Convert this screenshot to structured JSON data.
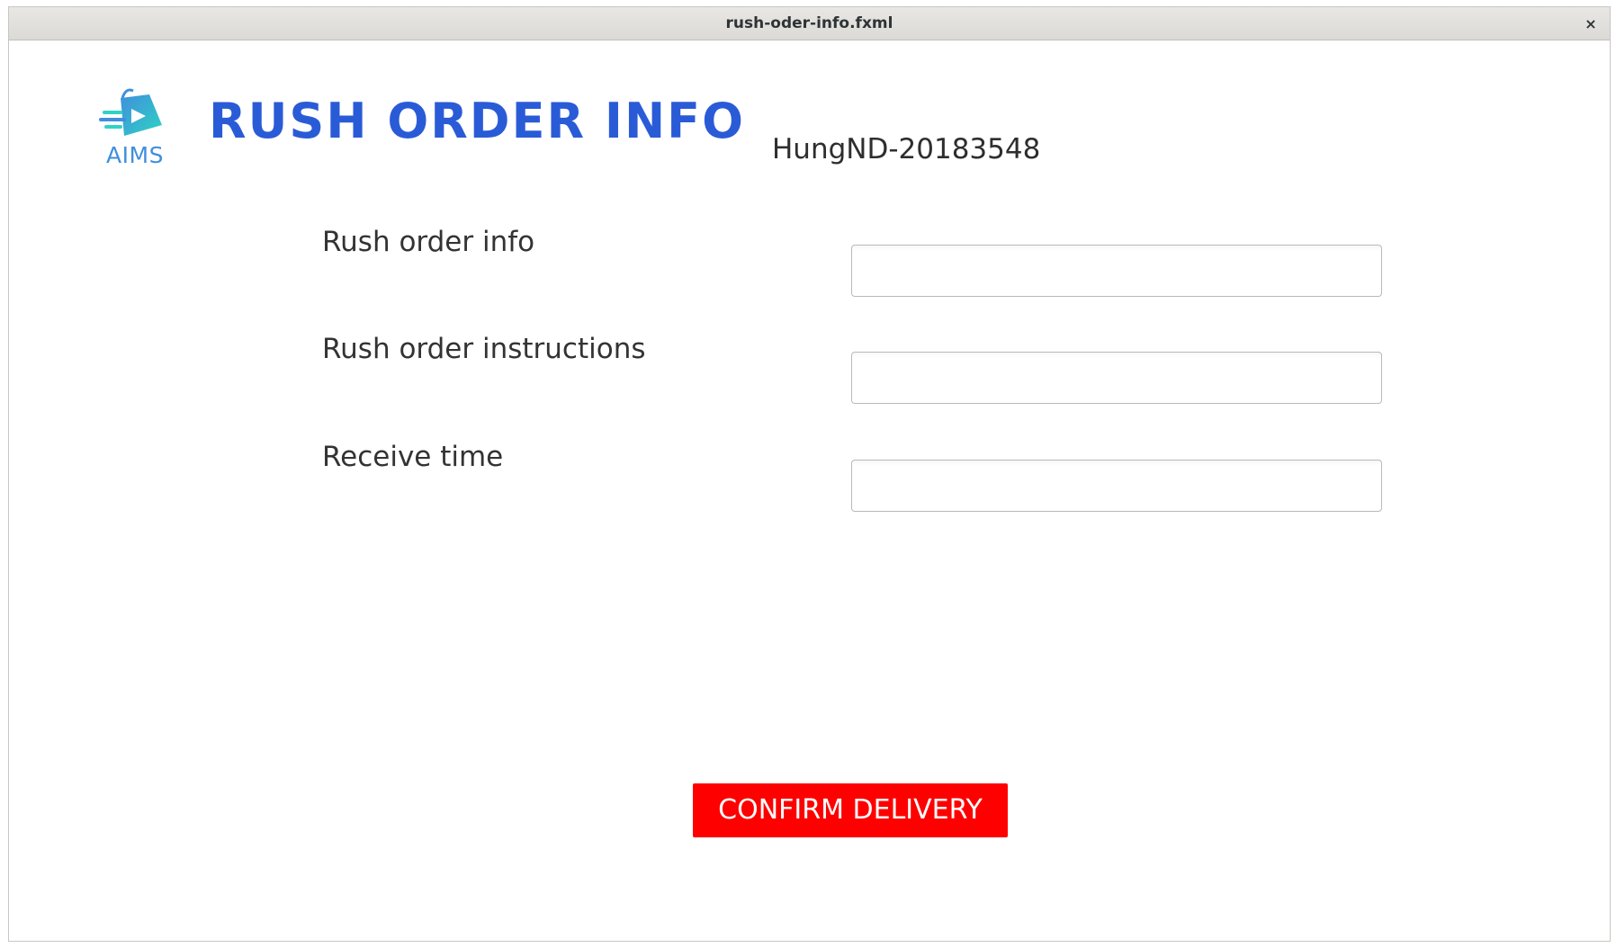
{
  "window": {
    "title": "rush-oder-info.fxml",
    "close_symbol": "×"
  },
  "header": {
    "logo_text": "AIMS",
    "logo_icon": "shopping-bag-arrow-icon",
    "title": "RUSH ORDER INFO",
    "student_id": "HungND-20183548"
  },
  "form": {
    "fields": [
      {
        "label": "Rush order info",
        "value": "",
        "placeholder": ""
      },
      {
        "label": "Rush order instructions",
        "value": "",
        "placeholder": ""
      },
      {
        "label": "Receive time",
        "value": "",
        "placeholder": ""
      }
    ]
  },
  "actions": {
    "confirm_label": "CONFIRM DELIVERY"
  },
  "colors": {
    "title_blue": "#2a5bd7",
    "logo_blue": "#3f8fdc",
    "logo_teal": "#2fd3c4",
    "confirm_red": "#ff0000"
  }
}
